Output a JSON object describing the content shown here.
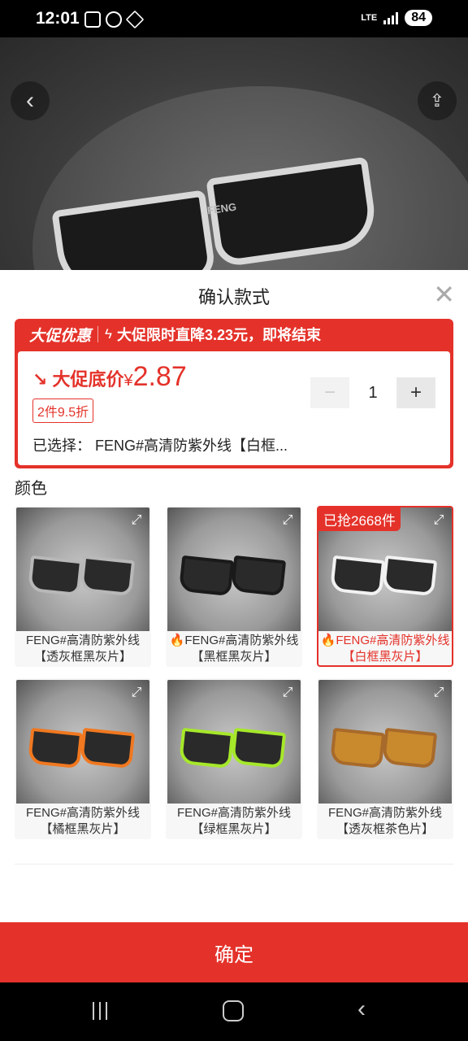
{
  "status": {
    "time": "12:01",
    "network": "LTE",
    "battery": "84"
  },
  "hero": {
    "brand": "FENG"
  },
  "sheet": {
    "title": "确认款式",
    "promo": {
      "tag": "大促优惠",
      "text": "大促限时直降3.23元，即将结束",
      "price_label": "大促底价",
      "currency": "¥",
      "price": "2.87",
      "discount_badge": "2件9.5折",
      "selected": "已选择：  FENG#高清防紫外线【白框..."
    },
    "quantity": {
      "minus": "−",
      "value": "1",
      "plus": "+"
    },
    "color_label": "颜色",
    "options": [
      {
        "line1": "FENG#高清防紫外线",
        "line2": "【透灰框黑灰片】",
        "hot": false,
        "selected": false,
        "frame": "#b8b8b8"
      },
      {
        "line1": "FENG#高清防紫外线",
        "line2": "【黑框黑灰片】",
        "hot": true,
        "selected": false,
        "frame": "#1a1a1a"
      },
      {
        "line1": "FENG#高清防紫外线",
        "line2": "【白框黑灰片】",
        "hot": true,
        "selected": true,
        "frame": "#f2f2f2",
        "sold": "已抢2668件"
      },
      {
        "line1": "FENG#高清防紫外线",
        "line2": "【橘框黑灰片】",
        "hot": false,
        "selected": false,
        "frame": "#f07820"
      },
      {
        "line1": "FENG#高清防紫外线",
        "line2": "【绿框黑灰片】",
        "hot": false,
        "selected": false,
        "frame": "#a6e82a"
      },
      {
        "line1": "FENG#高清防紫外线",
        "line2": "【透灰框茶色片】",
        "hot": false,
        "selected": false,
        "frame": "#a86a2a"
      }
    ],
    "confirm": "确定"
  },
  "colors": {
    "accent": "#e4322a"
  }
}
